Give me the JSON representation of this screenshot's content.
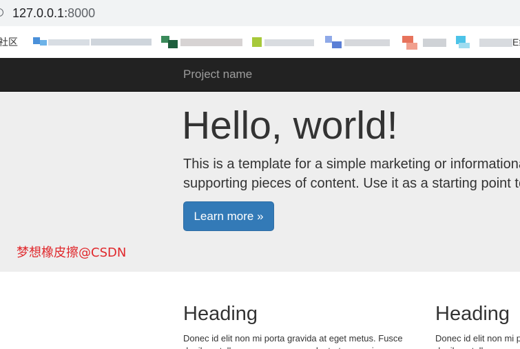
{
  "browser": {
    "url_host": "127.0.0.1:",
    "url_port": "8000",
    "bookmarks": {
      "left_fragment": "社区",
      "right_fragment": "E练"
    }
  },
  "navbar": {
    "brand": "Project name"
  },
  "jumbotron": {
    "title": "Hello, world!",
    "text_line1": "This is a template for a simple marketing or informationa",
    "text_line2": "supporting pieces of content. Use it as a starting point to",
    "button_label": "Learn more »",
    "watermark": "梦想橡皮擦@CSDN"
  },
  "columns": [
    {
      "heading": "Heading",
      "body": "Donec id elit non mi porta gravida at eget metus. Fusce dapibus, tellus ac cursus commodo, tortor mauris"
    },
    {
      "heading": "Heading",
      "body": "Donec id elit non mi porta gravida at eget metus. Fusce dapibus, tellus ac cursus commodo, tortor mauris"
    }
  ],
  "colors": {
    "navbar_bg": "#222222",
    "brand": "#9d9d9d",
    "jumbotron_bg": "#eeeeee",
    "primary": "#337ab7",
    "watermark": "#e0282c"
  },
  "icons": {
    "address_bar": "info-icon"
  }
}
